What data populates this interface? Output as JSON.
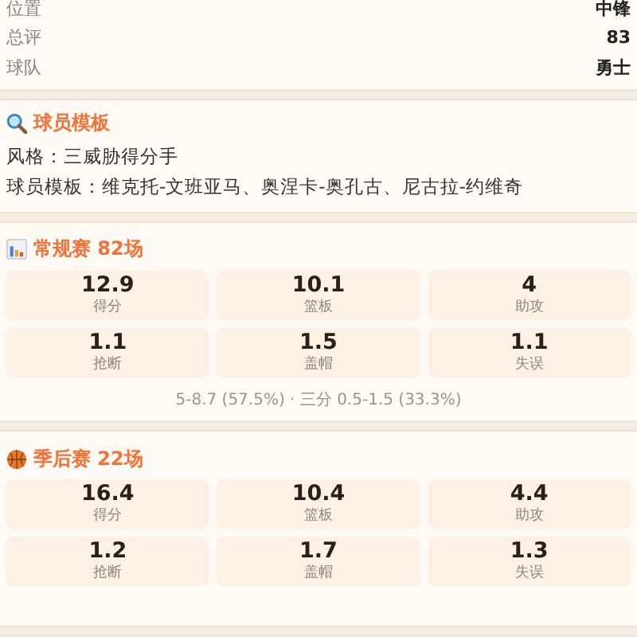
{
  "info_rows": [
    {
      "label": "位置",
      "value": "中锋"
    },
    {
      "label": "总评",
      "value": "83"
    },
    {
      "label": "球队",
      "value": "勇士"
    }
  ],
  "template": {
    "title": "球员模板",
    "lines": [
      "风格：三威胁得分手",
      "球员模板：维克托-文班亚马、奥涅卡-奥孔古、尼古拉-约维奇"
    ]
  },
  "sections": [
    {
      "kind": "chart",
      "title": "常规赛 82场",
      "stats": [
        {
          "value": "12.9",
          "label": "得分"
        },
        {
          "value": "10.1",
          "label": "篮板"
        },
        {
          "value": "4",
          "label": "助攻"
        },
        {
          "value": "1.1",
          "label": "抢断"
        },
        {
          "value": "1.5",
          "label": "盖帽"
        },
        {
          "value": "1.1",
          "label": "失误"
        }
      ],
      "note": "5-8.7 (57.5%) · 三分 0.5-1.5 (33.3%)"
    },
    {
      "kind": "ball",
      "title": "季后赛 22场",
      "stats": [
        {
          "value": "16.4",
          "label": "得分"
        },
        {
          "value": "10.4",
          "label": "篮板"
        },
        {
          "value": "4.4",
          "label": "助攻"
        },
        {
          "value": "1.2",
          "label": "抢断"
        },
        {
          "value": "1.7",
          "label": "盖帽"
        },
        {
          "value": "1.3",
          "label": "失误"
        }
      ]
    }
  ]
}
